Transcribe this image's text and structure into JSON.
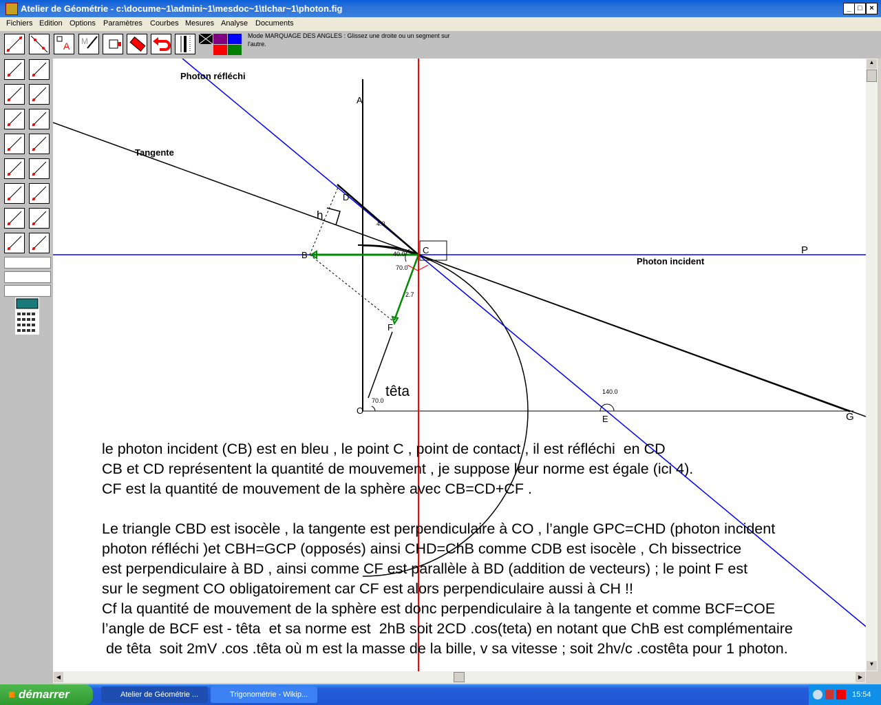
{
  "window": {
    "title": "Atelier de Géométrie - c:\\docume~1\\admini~1\\mesdoc~1\\tlchar~1\\photon.fig",
    "controls": [
      "_",
      "□",
      "×"
    ]
  },
  "menu": [
    "Fichiers",
    "Edition",
    "Options",
    "Paramètres",
    "Courbes",
    "Mesures",
    "Analyse",
    "Documents"
  ],
  "status": "Mode MARQUAGE DES ANGLES : Glissez une droite ou un segment sur l'autre.",
  "palette": [
    "#000000",
    "#800080",
    "#0000ff",
    "#c0c0c0",
    "#ff0000",
    "#008000"
  ],
  "figure": {
    "labels": {
      "photon_reflechi": "Photon réfléchi",
      "tangente": "Tangente",
      "photon_incident": "Photon incident",
      "teta": "têta",
      "h": "h"
    },
    "points": {
      "A": "A",
      "B": "B",
      "C": "C",
      "D": "D",
      "E": "E",
      "F": "F",
      "G": "G",
      "O": "O",
      "P": "P"
    },
    "measures": {
      "cd": "4.0",
      "cf": "2.7",
      "angle_40": "40.0",
      "angle_70": "70.0",
      "angle_o": "70.0",
      "angle_e": "140.0"
    }
  },
  "text": [
    "le photon incident (CB) est en bleu , le point C , point de contact , il est réfléchi  en CD",
    "CB et CD représentent la quantité de mouvement , je suppose leur norme est égale (ici 4).",
    "CF est la quantité de mouvement de la sphère avec CB=CD+CF .",
    "",
    "Le triangle CBD est isocèle , la tangente est perpendiculaire à CO , l’angle GPC=CHD (photon incident",
    "photon réfléchi )et CBH=GCP (opposés) ainsi CHD=ChB comme CDB est isocèle , Ch bissectrice",
    "est perpendiculaire à BD , ainsi comme CF est parallèle à BD (addition de vecteurs) ; le point F est",
    "sur le segment CO obligatoirement car CF est alors perpendiculaire aussi à CH !!",
    "Cf la quantité de mouvement de la sphère est donc perpendiculaire à la tangente et comme BCF=COE",
    "l’angle de BCF est - têta  et sa norme est  2hB soit 2CD .cos(teta) en notant que ChB est complémentaire",
    " de têta  soit 2mV .cos .têta où m est la masse de la bille, v sa vitesse ; soit 2hv/c .costêta pour 1 photon."
  ],
  "taskbar": {
    "start": "démarrer",
    "tasks": [
      "Atelier de Géométrie ...",
      "Trigonométrie - Wikip..."
    ],
    "clock": "15:54"
  }
}
